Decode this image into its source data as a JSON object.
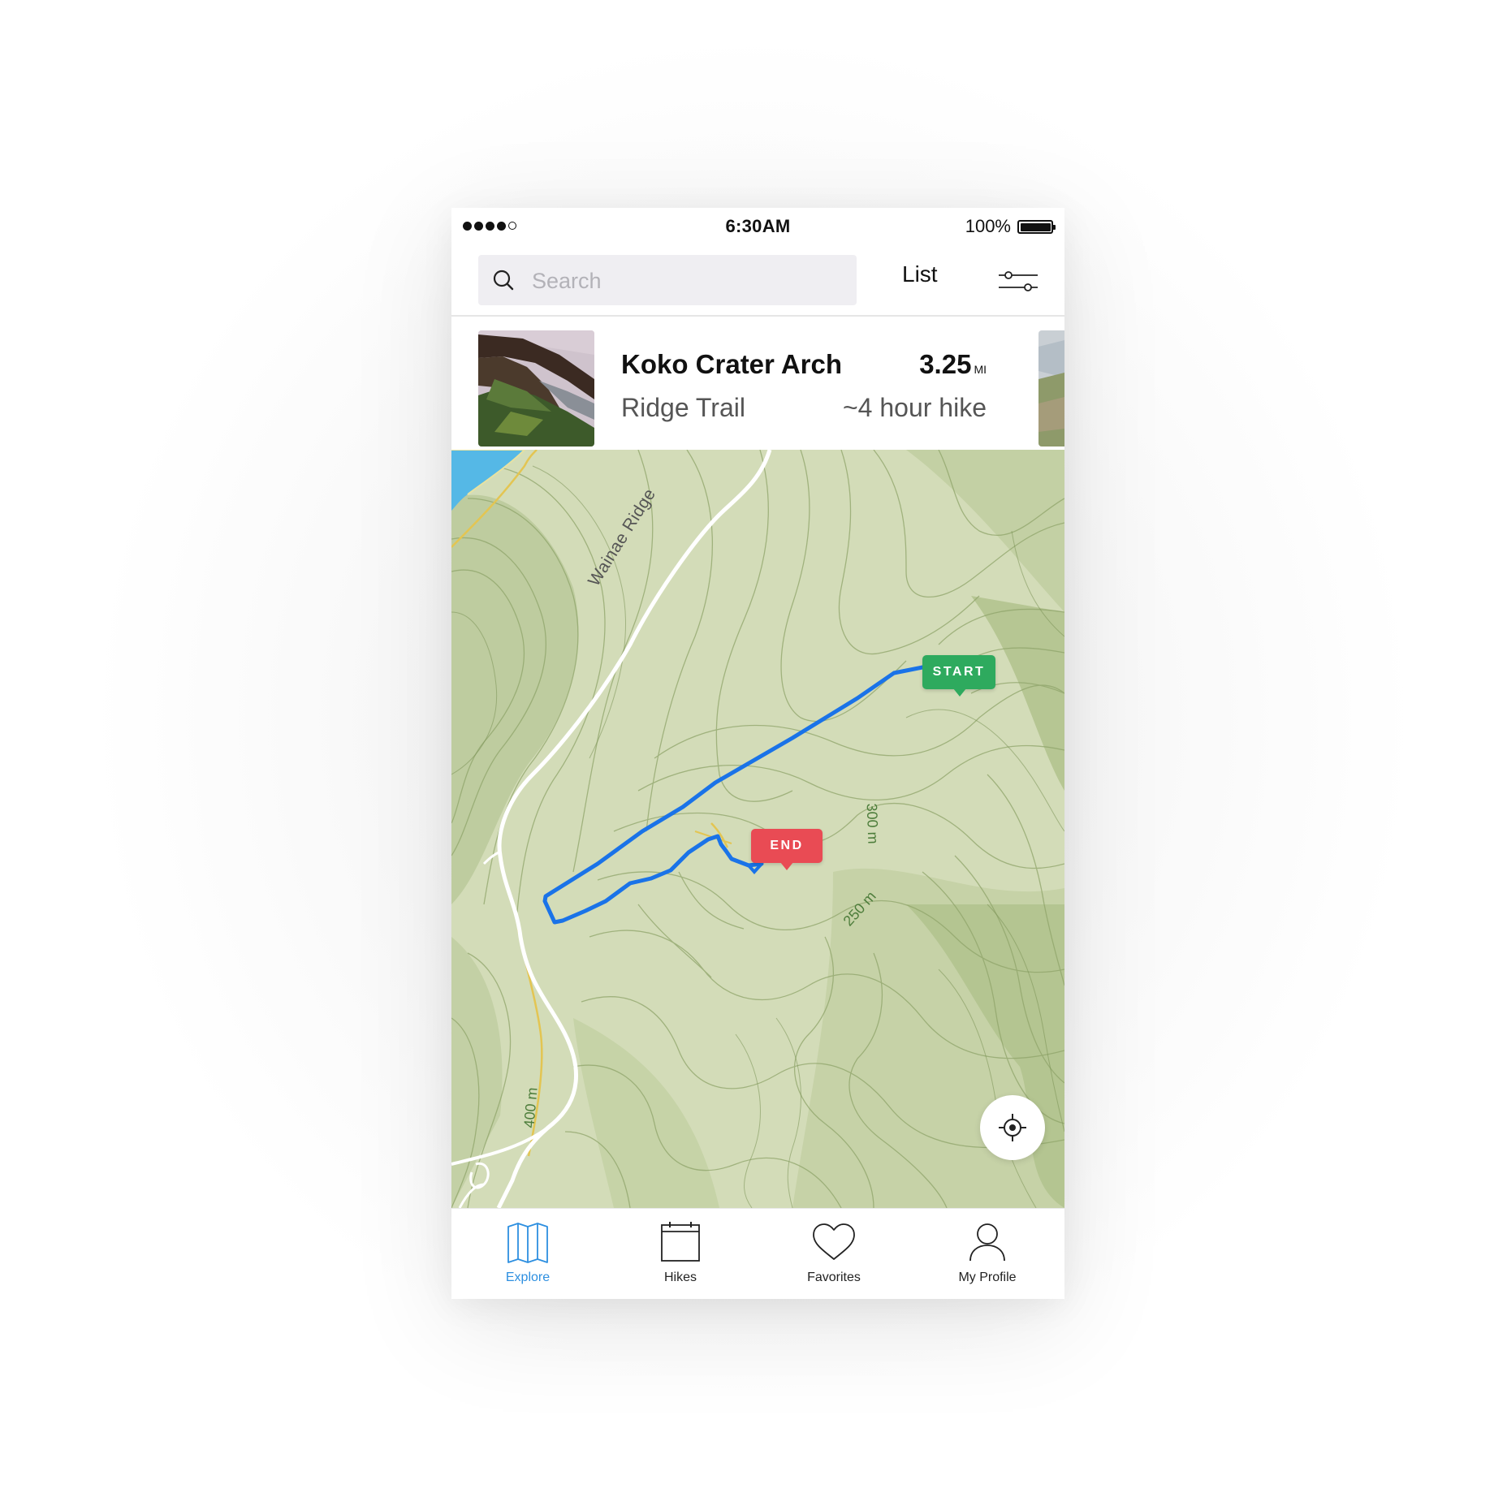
{
  "status_bar": {
    "time": "6:30AM",
    "battery_percent": "100%",
    "signal_bars_filled": 4,
    "signal_bars_total": 5
  },
  "search": {
    "placeholder": "Search",
    "value": ""
  },
  "header": {
    "list_label": "List",
    "filter_icon": "sliders-icon"
  },
  "hike_card": {
    "name": "Koko Crater Arch",
    "subtitle": "Ridge Trail",
    "distance": "3.25",
    "distance_unit": "MI",
    "duration": "~4 hour hike"
  },
  "map": {
    "road_label": "Wainae Ridge",
    "start_label": "START",
    "end_label": "END",
    "elevation_labels": [
      "300 m",
      "250 m",
      "400 m"
    ],
    "route_color": "#1a73e8",
    "start_color": "#2eaa5e",
    "end_color": "#e94b54",
    "locate_icon": "crosshair-icon"
  },
  "tabs": [
    {
      "label": "Explore",
      "icon": "map-icon",
      "active": true
    },
    {
      "label": "Hikes",
      "icon": "calendar-icon",
      "active": false
    },
    {
      "label": "Favorites",
      "icon": "heart-icon",
      "active": false
    },
    {
      "label": "My Profile",
      "icon": "user-icon",
      "active": false
    }
  ],
  "colors": {
    "accent": "#2d8fe0",
    "map_base": "#d3dcb8",
    "contour": "#8fa46a"
  }
}
